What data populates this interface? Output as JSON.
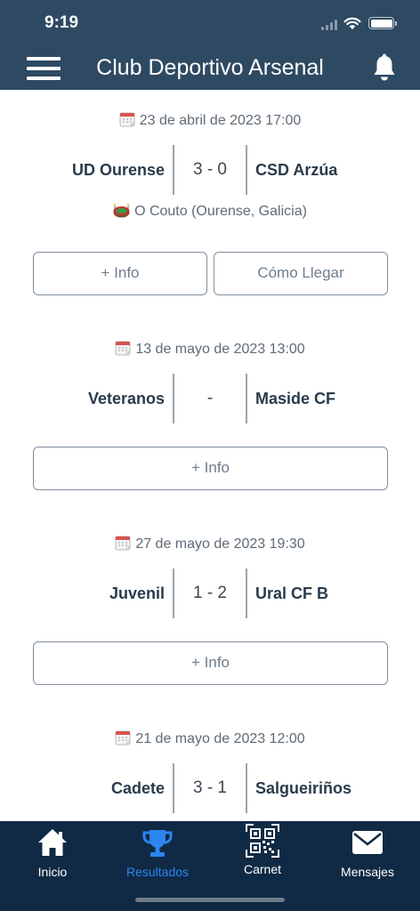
{
  "status_bar": {
    "time": "9:19"
  },
  "header": {
    "title": "Club Deportivo Arsenal"
  },
  "matches": [
    {
      "date": "23 de abril de 2023 17:00",
      "home": "UD Ourense",
      "score": "3 - 0",
      "away": "CSD Arzúa",
      "venue": "O Couto (Ourense, Galicia)",
      "info_label": "+ Info",
      "directions_label": "Cómo Llegar"
    },
    {
      "date": "13 de mayo de 2023 13:00",
      "home": "Veteranos",
      "score": "-",
      "away": "Maside CF",
      "info_label": "+ Info"
    },
    {
      "date": "27 de mayo de 2023 19:30",
      "home": "Juvenil",
      "score": "1 - 2",
      "away": "Ural CF B",
      "info_label": "+ Info"
    },
    {
      "date": "21 de mayo de 2023 12:00",
      "home": "Cadete",
      "score": "3 - 1",
      "away": "Salgueiriños"
    }
  ],
  "tabbar": {
    "items": [
      {
        "label": "Inicio",
        "icon": "home-icon"
      },
      {
        "label": "Resultados",
        "icon": "trophy-icon",
        "active": true
      },
      {
        "label": "Carnet",
        "icon": "qr-code-icon"
      },
      {
        "label": "Mensajes",
        "icon": "mail-icon"
      }
    ]
  },
  "colors": {
    "header_bg": "#2e4962",
    "tabbar_bg": "#102a45",
    "active_tab": "#2b86f0"
  }
}
